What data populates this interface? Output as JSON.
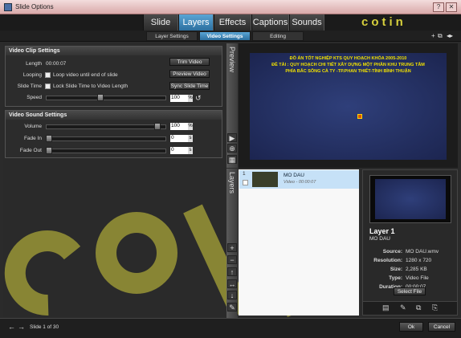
{
  "window": {
    "title": "Slide Options"
  },
  "main_tabs": [
    "Slide",
    "Layers",
    "Effects",
    "Captions",
    "Sounds"
  ],
  "logo_text": "cotin",
  "sub_tabs": [
    "Layer Settings",
    "Video Settings",
    "Editing"
  ],
  "video_clip": {
    "heading": "Video Clip Settings",
    "length_label": "Length",
    "length_value": "00:00:07",
    "looping_label": "Looping",
    "looping_text": "Loop video until end of slide",
    "slide_time_label": "Slide Time",
    "slide_time_text": "Lock Slide Time to Video Length",
    "speed_label": "Speed",
    "speed_value": "100",
    "speed_unit": "%",
    "trim_button": "Trim Video",
    "preview_button": "Preview Video",
    "sync_button": "Sync Slide Time"
  },
  "video_sound": {
    "heading": "Video Sound Settings",
    "volume_label": "Volume",
    "volume_value": "100",
    "volume_unit": "%",
    "fade_in_label": "Fade In",
    "fade_in_value": "0",
    "fade_out_label": "Fade Out",
    "fade_out_value": "0",
    "seconds_unit": "s"
  },
  "preview": {
    "label": "Preview",
    "line1": "ĐỒ ÁN TỐT NGHIỆP KTS QUY HOẠCH KHÓA 2005-2010",
    "line2": "ĐỀ TÀI : QUY HOẠCH CHI TIẾT XÂY DỰNG MỘT PHẦN KHU TRUNG TÂM",
    "line3": "PHÍA BẮC SÔNG CÀ TY -TP.PHAN THIẾT-TỈNH BÌNH THUẬN"
  },
  "layers": {
    "label": "Layers",
    "items": [
      {
        "number": "1",
        "name": "MO DAU",
        "sub": "Video - 00:00:07"
      }
    ]
  },
  "layer_info": {
    "title": "Layer 1",
    "subtitle": "MO DAU",
    "source_key": "Source:",
    "source": "MO DAU.wmv",
    "resolution_key": "Resolution:",
    "resolution": "1280 x 720",
    "size_key": "Size:",
    "size": "2,285 KB",
    "type_key": "Type:",
    "type": "Video File",
    "duration_key": "Duration:",
    "duration": "00:00:07",
    "select_button": "Select File"
  },
  "status": {
    "slide_text": "Slide 1 of 30",
    "ok_button": "Ok",
    "cancel_button": "Cancel"
  },
  "colors": {
    "accent": "#3a8cc4",
    "preview_text": "#f0e000",
    "watermark": "#d6cf3c"
  },
  "sliders": {
    "speed_fraction": 0.45,
    "volume_fraction": 0.95,
    "fade_in_fraction": 0.0,
    "fade_out_fraction": 0.0
  }
}
